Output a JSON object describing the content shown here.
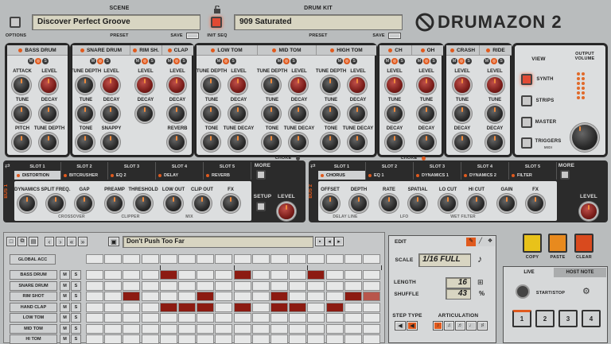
{
  "header": {
    "scene_label": "SCENE",
    "scene_value": "Discover Perfect Groove",
    "options_label": "OPTIONS",
    "preset_label": "PRESET",
    "save_label": "SAVE",
    "drumkit_label": "DRUM KIT",
    "drumkit_value": "909 Saturated",
    "initseq_label": "INIT SEQ",
    "preset2_label": "PRESET",
    "save2_label": "SAVE",
    "logo": "DRUMAZON 2"
  },
  "instruments": [
    {
      "name": "BASS DRUM",
      "knobs": [
        "ATTACK",
        "LEVEL",
        "TUNE",
        "DECAY",
        "PITCH",
        "TUNE DEPTH"
      ]
    },
    {
      "name": "SNARE DRUM",
      "knobs": [
        "TUNE DEPTH",
        "LEVEL",
        "TUNE",
        "DECAY",
        "TONE",
        "SNAPPY"
      ]
    },
    {
      "name": "RIM SH.",
      "knobs": [
        "LEVEL",
        "DECAY"
      ]
    },
    {
      "name": "CLAP",
      "knobs": [
        "LEVEL",
        "DECAY",
        "REVERB"
      ]
    },
    {
      "name": "LOW TOM",
      "knobs": [
        "TUNE DEPTH",
        "LEVEL",
        "TUNE",
        "DECAY",
        "TONE",
        "TUNE DECAY"
      ]
    },
    {
      "name": "MID TOM",
      "knobs": [
        "TUNE DEPTH",
        "LEVEL",
        "TUNE",
        "DECAY",
        "TONE",
        "TUNE DECAY"
      ]
    },
    {
      "name": "HIGH TOM",
      "knobs": [
        "TUNE DEPTH",
        "LEVEL",
        "TUNE",
        "DECAY",
        "TONE",
        "TUNE DECAY"
      ]
    },
    {
      "name": "CH",
      "knobs": [
        "LEVEL",
        "TUNE",
        "DECAY",
        "DECAY"
      ]
    },
    {
      "name": "OH",
      "knobs": [
        "LEVEL",
        "TUNE",
        "DECAY",
        "DECAY"
      ]
    },
    {
      "name": "CRASH",
      "knobs": [
        "LEVEL",
        "TUNE",
        "DECAY"
      ]
    },
    {
      "name": "RIDE",
      "knobs": [
        "LEVEL",
        "TUNE",
        "DECAY"
      ]
    }
  ],
  "choke_label": "CHOKE",
  "view": {
    "title": "VIEW",
    "output_label": "OUTPUT VOLUME",
    "items": [
      "SYNTH",
      "STRIPS",
      "MASTER",
      "TRIGGERS"
    ],
    "triggers_sub": "MIDI"
  },
  "bus1": {
    "label": "BUS 1",
    "slots": [
      "DISTORTION",
      "BITCRUSHER",
      "EQ 2",
      "DELAY",
      "REVERB"
    ],
    "slot_nums": [
      "SLOT 1",
      "SLOT 2",
      "SLOT 3",
      "SLOT 4",
      "SLOT 5"
    ],
    "more": "MORE",
    "setup": "SETUP",
    "knobs": [
      "DYNAMICS",
      "SPLIT FREQ.",
      "GAP",
      "PREAMP",
      "THRESHOLD",
      "LOW OUT",
      "CLIP OUT",
      "FX"
    ],
    "groups": [
      "CROSSOVER",
      "CLIPPER",
      "MIX"
    ],
    "level": "LEVEL"
  },
  "bus2": {
    "label": "BUS 2",
    "slots": [
      "CHORUS",
      "EQ 1",
      "DYNAMICS 1",
      "DYNAMICS 2",
      "FILTER"
    ],
    "slot_nums": [
      "SLOT 1",
      "SLOT 2",
      "SLOT 3",
      "SLOT 4",
      "SLOT 5"
    ],
    "more": "MORE",
    "knobs": [
      "OFFSET",
      "DEPTH",
      "RATE",
      "SPATIAL",
      "LO CUT",
      "HI CUT",
      "GAIN",
      "FX"
    ],
    "groups": [
      "DELAY LINE",
      "LFO",
      "WET FILTER"
    ],
    "level": "LEVEL"
  },
  "sequencer": {
    "pattern_name": "Don't Push Too Far",
    "global_acc": "GLOBAL ACC",
    "rows": [
      "BASS DRUM",
      "SNARE DRUM",
      "RIM SHOT",
      "HAND CLAP",
      "LOW TOM",
      "MID TOM",
      "HI TOM"
    ],
    "m": "M",
    "s": "S"
  },
  "edit": {
    "title": "EDIT",
    "scale_label": "SCALE",
    "scale_value": "1/16 FULL",
    "length_label": "LENGTH",
    "length_value": "16",
    "shuffle_label": "SHUFFLE",
    "shuffle_value": "43",
    "shuffle_unit": "%",
    "step_type": "STEP TYPE",
    "articulation": "ARTICULATION"
  },
  "actions": {
    "copy": "COPY",
    "paste": "PASTE",
    "clear": "CLEAR",
    "live": "LIVE",
    "host_note": "HOST NOTE",
    "start_stop": "START/STOP",
    "pads": [
      "1",
      "2",
      "3",
      "4"
    ]
  },
  "colors": {
    "accent": "#e05a1e",
    "step_on": "#8c1b12",
    "panel_dark": "#2b2b2b"
  }
}
